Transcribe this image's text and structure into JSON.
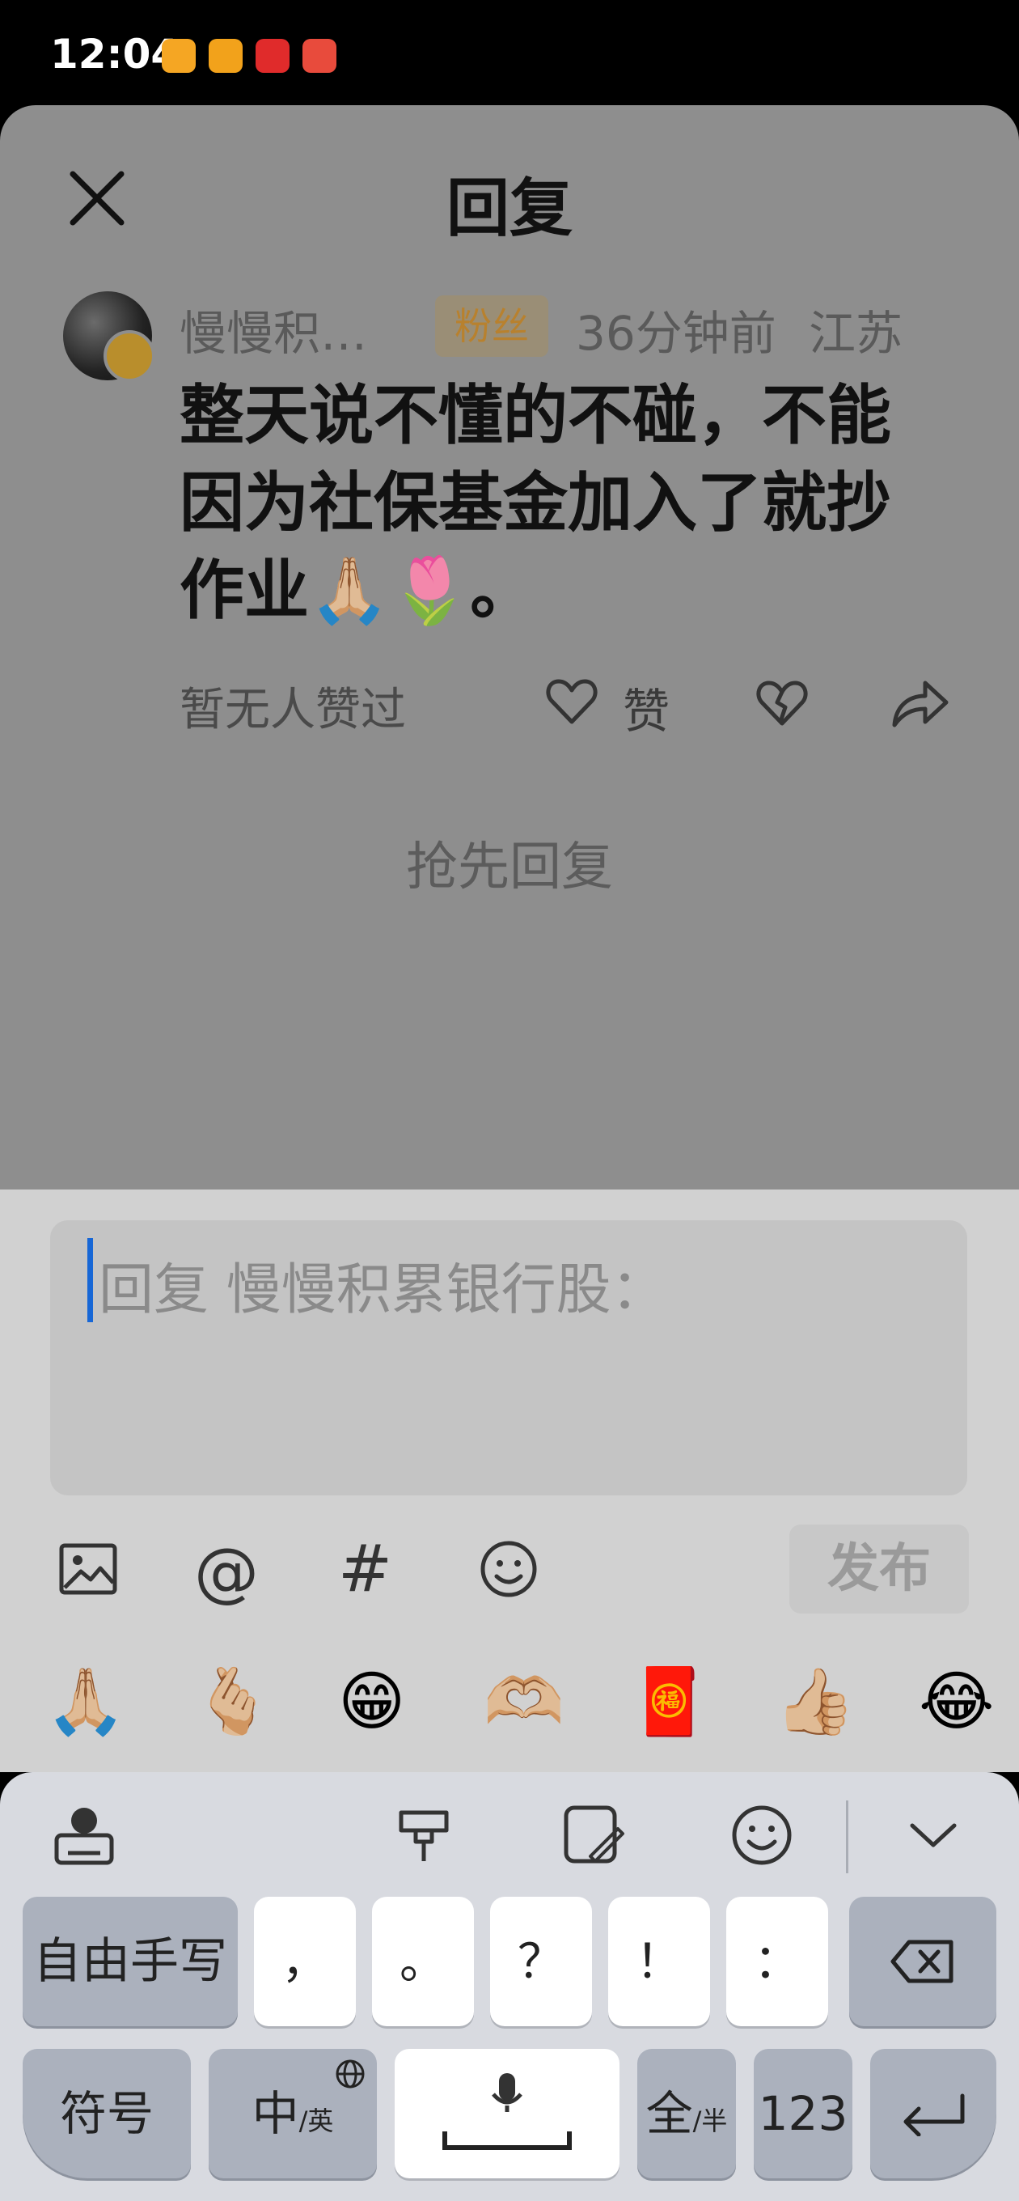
{
  "status_bar": {
    "time": "12:04"
  },
  "header": {
    "title": "回复"
  },
  "comment": {
    "username": "慢慢积…",
    "fan_badge": "粉丝",
    "time_ago": "36分钟前",
    "region": "江苏",
    "text": "整天说不懂的不碰，不能因为社保基金加入了就抄作业🙏🏼🌷。",
    "likes_text": "暂无人赞过",
    "like_label": "赞"
  },
  "first_reply_prompt": "抢先回复",
  "composer": {
    "placeholder": "回复 慢慢积累银行股：",
    "at_symbol": "@",
    "hash_symbol": "#",
    "publish_label": "发布"
  },
  "quick_emojis": [
    "🙏🏼",
    "🫰🏼",
    "😁",
    "🫶🏼",
    "🧧",
    "👍🏼",
    "😂"
  ],
  "keyboard": {
    "handwriting_key": "自由手写",
    "punct_keys": [
      "，",
      "。",
      "？",
      "！",
      "："
    ],
    "symbols_key": "符号",
    "lang_key_main": "中",
    "lang_key_sub": "/英",
    "fullwidth_key_main": "全",
    "fullwidth_key_sub": "/半",
    "numbers_key": "123"
  }
}
